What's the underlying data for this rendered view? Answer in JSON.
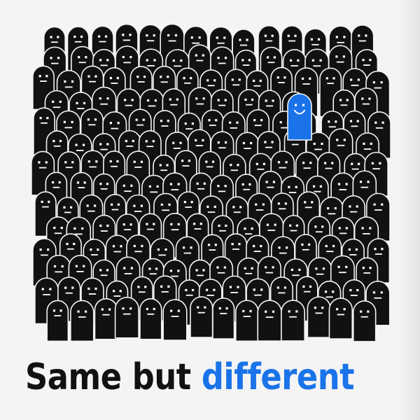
{
  "caption": {
    "same_text": "Same but ",
    "different_text": "different"
  },
  "crowd": {
    "description_count": 178,
    "figure_icon": "ghost-figure-icon",
    "odd_one_out_icon": "smiling-blue-figure-icon",
    "face_expression": "neutral",
    "odd_one_out_expression": "smile"
  },
  "colors": {
    "background": "#f4f4f4",
    "figure": "#111111",
    "figure_face": "#ffffff",
    "odd_one_out": "#1a73e8",
    "caption_same": "#111111",
    "caption_different": "#1a73e8"
  }
}
